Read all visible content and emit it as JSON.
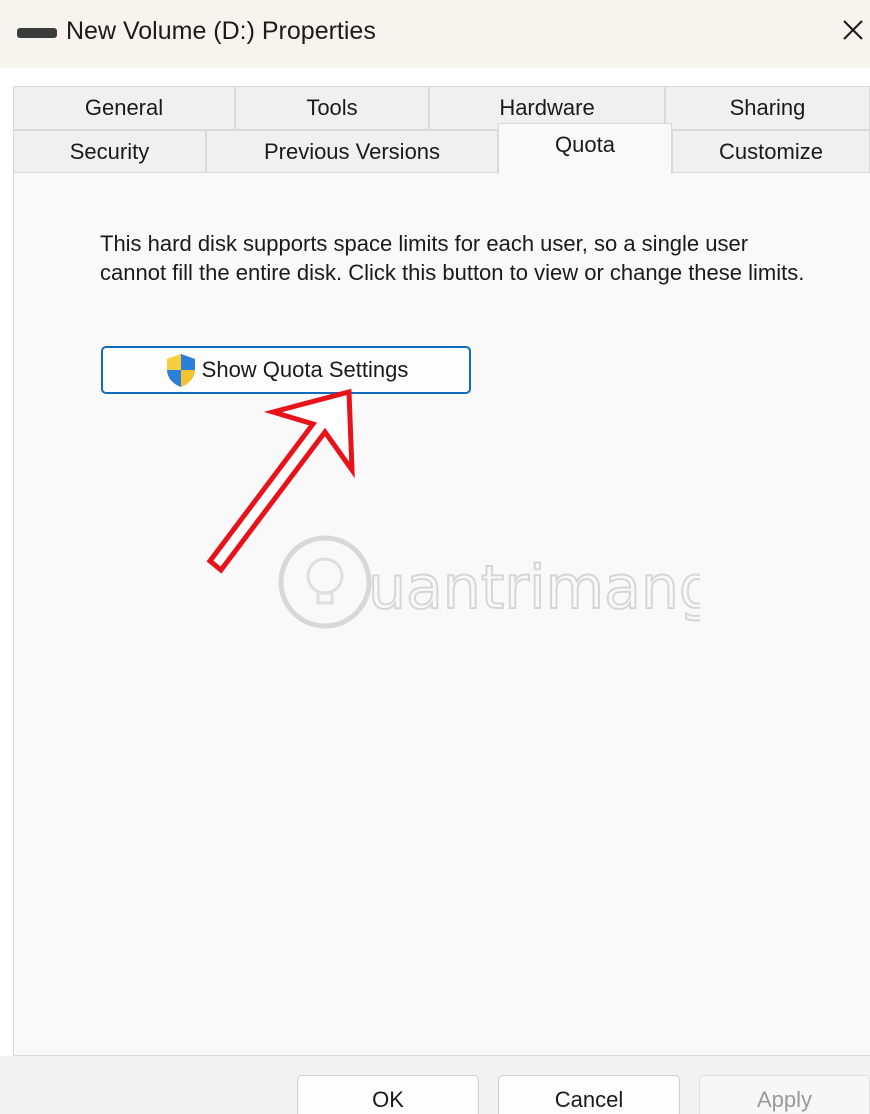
{
  "window": {
    "title": "New Volume (D:) Properties",
    "close_glyph": "×"
  },
  "tabs": {
    "row1": [
      {
        "label": "General"
      },
      {
        "label": "Tools"
      },
      {
        "label": "Hardware"
      },
      {
        "label": "Sharing"
      }
    ],
    "row2": [
      {
        "label": "Security"
      },
      {
        "label": "Previous Versions"
      },
      {
        "label": "Quota",
        "selected": true
      },
      {
        "label": "Customize"
      }
    ]
  },
  "quota": {
    "description": "This hard disk supports space limits for each user, so a single user cannot fill the entire disk. Click this button to view or change these limits.",
    "button_label": "Show Quota Settings",
    "button_icon": "uac-shield-icon"
  },
  "watermark": {
    "text": "uantrimang",
    "icon": "lightbulb-icon"
  },
  "footer": {
    "ok_label": "OK",
    "cancel_label": "Cancel",
    "apply_label": "Apply"
  },
  "colors": {
    "accent": "#0f6cbd",
    "annotation": "#e8121a"
  }
}
